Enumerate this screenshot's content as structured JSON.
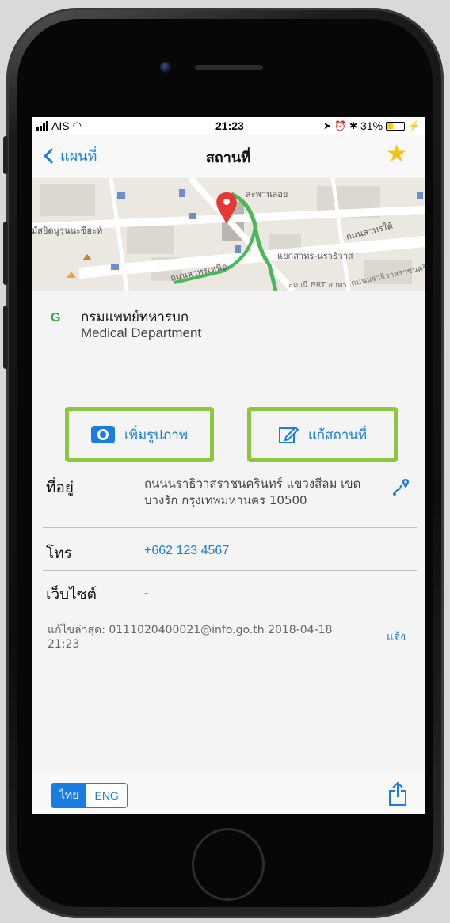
{
  "status": {
    "carrier": "AIS",
    "time": "21:23",
    "battery": "31%"
  },
  "nav": {
    "back_label": "แผนที่",
    "title": "สถานที่"
  },
  "map": {
    "labels": [
      "สะพานลอย",
      "มัสยิดนูรุนนะซีฮะห์",
      "ถนนสาทรใต้",
      "แยกสาทร-นราธิวาส",
      "ถนนสาทรเหนือ",
      "สถานี BRT สาทร",
      "ถนนนราธิวาสราชนครินทร์ S"
    ]
  },
  "place": {
    "icon_letter": "G",
    "name_th": "กรมแพทย์ทหารบก",
    "name_en": "Medical Department"
  },
  "actions": {
    "add_photo": "เพิ่มรูปภาพ",
    "edit_place": "แก้สถานที่"
  },
  "info": {
    "address_label": "ที่อยู่",
    "address_value": "ถนนนราธิวาสราชนครินทร์ แขวงสีลม เขต บางรัก กรุงเทพมหานคร 10500",
    "phone_label": "โทร",
    "phone_value": "+662 123 4567",
    "website_label": "เว็บไซต์",
    "website_value": "-"
  },
  "last_edit": "แก้ไขล่าสุด: 0111020400021@info.go.th 2018-04-18 21:23",
  "report_label": "แจ้ง",
  "toolbar": {
    "lang_th": "ไทย",
    "lang_en": "ENG"
  },
  "colors": {
    "accent": "#1a7ee0",
    "highlight": "#8dc63f",
    "star": "#f6c40f",
    "pin": "#e53935"
  }
}
